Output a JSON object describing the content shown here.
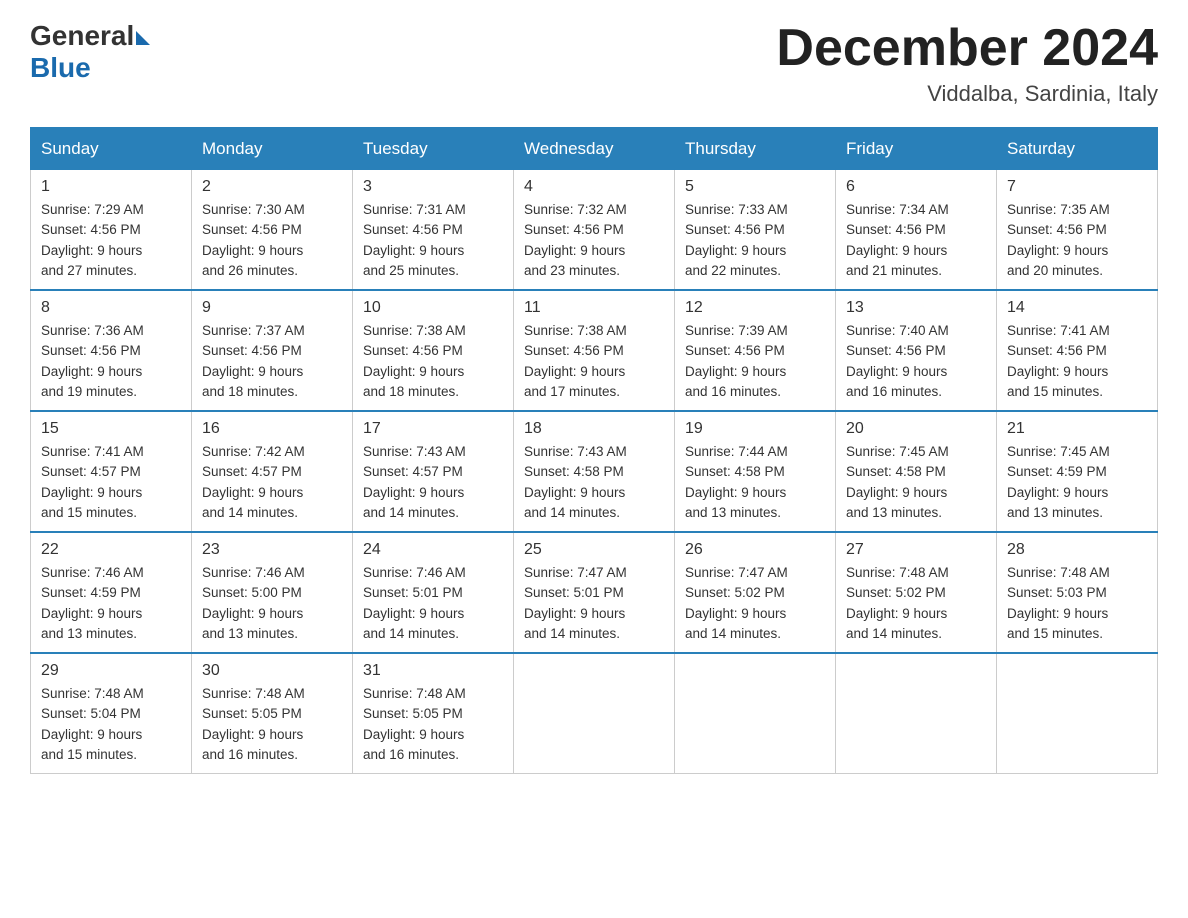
{
  "header": {
    "logo_general": "General",
    "logo_blue": "Blue",
    "month_title": "December 2024",
    "location": "Viddalba, Sardinia, Italy"
  },
  "days_of_week": [
    "Sunday",
    "Monday",
    "Tuesday",
    "Wednesday",
    "Thursday",
    "Friday",
    "Saturday"
  ],
  "weeks": [
    [
      {
        "day": "1",
        "sunrise": "7:29 AM",
        "sunset": "4:56 PM",
        "daylight": "9 hours and 27 minutes."
      },
      {
        "day": "2",
        "sunrise": "7:30 AM",
        "sunset": "4:56 PM",
        "daylight": "9 hours and 26 minutes."
      },
      {
        "day": "3",
        "sunrise": "7:31 AM",
        "sunset": "4:56 PM",
        "daylight": "9 hours and 25 minutes."
      },
      {
        "day": "4",
        "sunrise": "7:32 AM",
        "sunset": "4:56 PM",
        "daylight": "9 hours and 23 minutes."
      },
      {
        "day": "5",
        "sunrise": "7:33 AM",
        "sunset": "4:56 PM",
        "daylight": "9 hours and 22 minutes."
      },
      {
        "day": "6",
        "sunrise": "7:34 AM",
        "sunset": "4:56 PM",
        "daylight": "9 hours and 21 minutes."
      },
      {
        "day": "7",
        "sunrise": "7:35 AM",
        "sunset": "4:56 PM",
        "daylight": "9 hours and 20 minutes."
      }
    ],
    [
      {
        "day": "8",
        "sunrise": "7:36 AM",
        "sunset": "4:56 PM",
        "daylight": "9 hours and 19 minutes."
      },
      {
        "day": "9",
        "sunrise": "7:37 AM",
        "sunset": "4:56 PM",
        "daylight": "9 hours and 18 minutes."
      },
      {
        "day": "10",
        "sunrise": "7:38 AM",
        "sunset": "4:56 PM",
        "daylight": "9 hours and 18 minutes."
      },
      {
        "day": "11",
        "sunrise": "7:38 AM",
        "sunset": "4:56 PM",
        "daylight": "9 hours and 17 minutes."
      },
      {
        "day": "12",
        "sunrise": "7:39 AM",
        "sunset": "4:56 PM",
        "daylight": "9 hours and 16 minutes."
      },
      {
        "day": "13",
        "sunrise": "7:40 AM",
        "sunset": "4:56 PM",
        "daylight": "9 hours and 16 minutes."
      },
      {
        "day": "14",
        "sunrise": "7:41 AM",
        "sunset": "4:56 PM",
        "daylight": "9 hours and 15 minutes."
      }
    ],
    [
      {
        "day": "15",
        "sunrise": "7:41 AM",
        "sunset": "4:57 PM",
        "daylight": "9 hours and 15 minutes."
      },
      {
        "day": "16",
        "sunrise": "7:42 AM",
        "sunset": "4:57 PM",
        "daylight": "9 hours and 14 minutes."
      },
      {
        "day": "17",
        "sunrise": "7:43 AM",
        "sunset": "4:57 PM",
        "daylight": "9 hours and 14 minutes."
      },
      {
        "day": "18",
        "sunrise": "7:43 AM",
        "sunset": "4:58 PM",
        "daylight": "9 hours and 14 minutes."
      },
      {
        "day": "19",
        "sunrise": "7:44 AM",
        "sunset": "4:58 PM",
        "daylight": "9 hours and 13 minutes."
      },
      {
        "day": "20",
        "sunrise": "7:45 AM",
        "sunset": "4:58 PM",
        "daylight": "9 hours and 13 minutes."
      },
      {
        "day": "21",
        "sunrise": "7:45 AM",
        "sunset": "4:59 PM",
        "daylight": "9 hours and 13 minutes."
      }
    ],
    [
      {
        "day": "22",
        "sunrise": "7:46 AM",
        "sunset": "4:59 PM",
        "daylight": "9 hours and 13 minutes."
      },
      {
        "day": "23",
        "sunrise": "7:46 AM",
        "sunset": "5:00 PM",
        "daylight": "9 hours and 13 minutes."
      },
      {
        "day": "24",
        "sunrise": "7:46 AM",
        "sunset": "5:01 PM",
        "daylight": "9 hours and 14 minutes."
      },
      {
        "day": "25",
        "sunrise": "7:47 AM",
        "sunset": "5:01 PM",
        "daylight": "9 hours and 14 minutes."
      },
      {
        "day": "26",
        "sunrise": "7:47 AM",
        "sunset": "5:02 PM",
        "daylight": "9 hours and 14 minutes."
      },
      {
        "day": "27",
        "sunrise": "7:48 AM",
        "sunset": "5:02 PM",
        "daylight": "9 hours and 14 minutes."
      },
      {
        "day": "28",
        "sunrise": "7:48 AM",
        "sunset": "5:03 PM",
        "daylight": "9 hours and 15 minutes."
      }
    ],
    [
      {
        "day": "29",
        "sunrise": "7:48 AM",
        "sunset": "5:04 PM",
        "daylight": "9 hours and 15 minutes."
      },
      {
        "day": "30",
        "sunrise": "7:48 AM",
        "sunset": "5:05 PM",
        "daylight": "9 hours and 16 minutes."
      },
      {
        "day": "31",
        "sunrise": "7:48 AM",
        "sunset": "5:05 PM",
        "daylight": "9 hours and 16 minutes."
      },
      null,
      null,
      null,
      null
    ]
  ],
  "labels": {
    "sunrise": "Sunrise:",
    "sunset": "Sunset:",
    "daylight": "Daylight:"
  }
}
